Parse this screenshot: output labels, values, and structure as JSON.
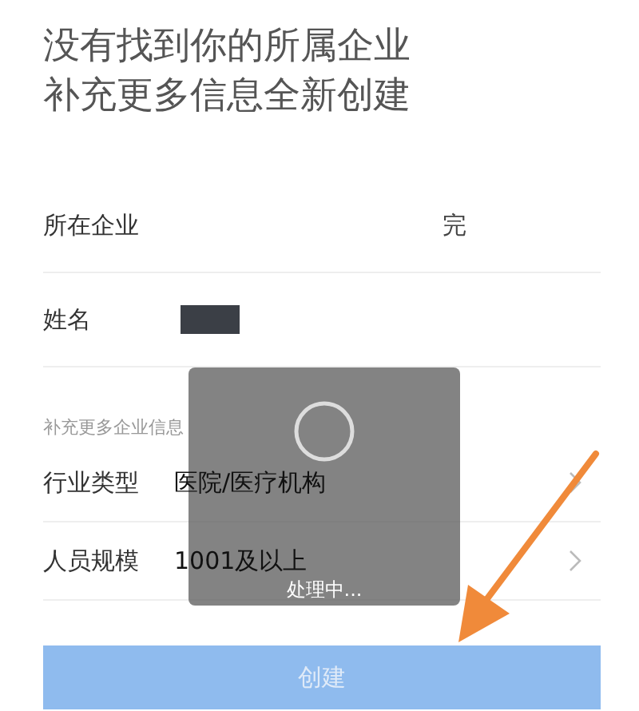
{
  "heading": [
    "没有找到你的所属企业",
    "补充更多信息全新创建"
  ],
  "fields": [
    {
      "kind": "text",
      "label": "所在企业",
      "value": "完"
    },
    {
      "kind": "redacted",
      "label": "姓名"
    }
  ],
  "section_label": "补充更多企业信息",
  "options": [
    {
      "label": "行业类型",
      "value": "医院/医疗机构"
    },
    {
      "label": "人员规模",
      "value": "1001及以上"
    }
  ],
  "create_button": {
    "label": "创建",
    "disabled": true
  },
  "loading_toast": {
    "message": "处理中..."
  }
}
